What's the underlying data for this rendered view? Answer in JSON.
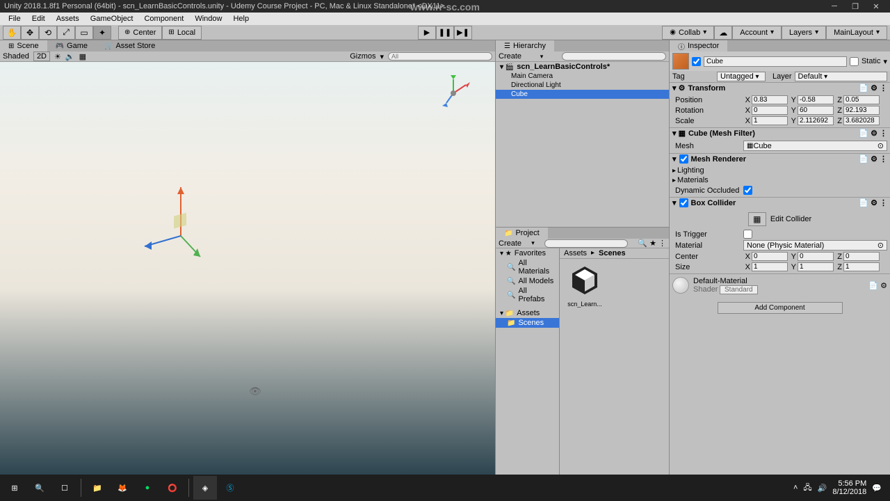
{
  "window": {
    "title": "Unity 2018.1.8f1 Personal (64bit) - scn_LearnBasicControls.unity - Udemy Course Project - PC, Mac & Linux Standalone* <DX11>"
  },
  "watermark": "www.rr-sc.com",
  "menu": [
    "File",
    "Edit",
    "Assets",
    "GameObject",
    "Component",
    "Window",
    "Help"
  ],
  "toolbar": {
    "pivot": "Center",
    "space": "Local",
    "collab": "Collab",
    "account": "Account",
    "layers": "Layers",
    "layout": "MainLayout"
  },
  "tabs": {
    "scene": "Scene",
    "game": "Game",
    "asset_store": "Asset Store",
    "hierarchy": "Hierarchy",
    "project": "Project",
    "inspector": "Inspector"
  },
  "scene_toolbar": {
    "shaded": "Shaded",
    "two_d": "2D",
    "gizmos": "Gizmos",
    "all": "All"
  },
  "hierarchy": {
    "create": "Create",
    "scene": "scn_LearnBasicControls*",
    "items": [
      "Main Camera",
      "Directional Light",
      "Cube"
    ]
  },
  "project": {
    "create": "Create",
    "breadcrumb_assets": "Assets",
    "breadcrumb_scenes": "Scenes",
    "favorites": "Favorites",
    "fav_items": [
      "All Materials",
      "All Models",
      "All Prefabs"
    ],
    "assets": "Assets",
    "scenes": "Scenes",
    "asset_name": "scn_Learn..."
  },
  "inspector": {
    "name": "Cube",
    "static": "Static",
    "tag_label": "Tag",
    "tag": "Untagged",
    "layer_label": "Layer",
    "layer": "Default",
    "transform": {
      "title": "Transform",
      "position": "Position",
      "px": "0.83",
      "py": "-0.58",
      "pz": "0.05",
      "rotation": "Rotation",
      "rx": "0",
      "ry": "60",
      "rz": "92.193",
      "scale": "Scale",
      "sx": "1",
      "sy": "2.112692",
      "sz": "3.682028"
    },
    "mesh_filter": {
      "title": "Cube (Mesh Filter)",
      "mesh_label": "Mesh",
      "mesh": "Cube"
    },
    "mesh_renderer": {
      "title": "Mesh Renderer",
      "lighting": "Lighting",
      "materials": "Materials",
      "dynamic_occluded": "Dynamic Occluded"
    },
    "box_collider": {
      "title": "Box Collider",
      "edit": "Edit Collider",
      "is_trigger": "Is Trigger",
      "material_label": "Material",
      "material": "None (Physic Material)",
      "center": "Center",
      "cx": "0",
      "cy": "0",
      "cz": "0",
      "size": "Size",
      "szx": "1",
      "szy": "1",
      "szz": "1"
    },
    "default_material": "Default-Material",
    "shader_label": "Shader",
    "shader": "Standard",
    "add_component": "Add Component"
  },
  "taskbar": {
    "time": "5:56 PM",
    "date": "8/12/2018"
  }
}
